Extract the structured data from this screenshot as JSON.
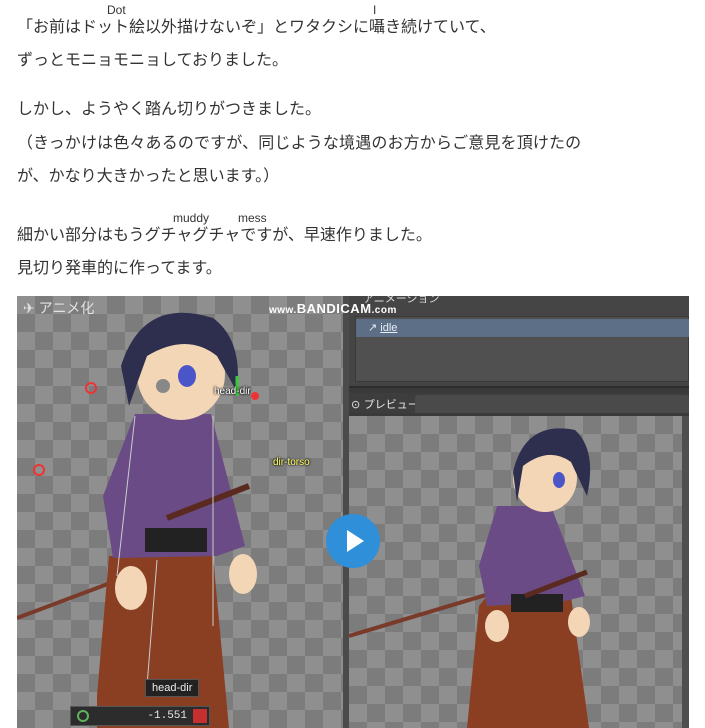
{
  "article": {
    "line1": "「お前はドット絵以外描けないぞ」とワタクシに囁き続けていて、",
    "line2": "ずっとモニョモニョしておりました。",
    "line3": "しかし、ようやく踏ん切りがつきました。",
    "line4": "（きっかけは色々あるのですが、同じような境遇のお方からご意見を頂けたの",
    "line5": "が、かなり大きかったと思います。）",
    "line6": "細かい部分はもうグチャグチャですが、早速作りました。",
    "line7": "見切り発車的に作ってます。",
    "ruby_dot": "Dot",
    "ruby_i": "I",
    "ruby_muddy": "muddy",
    "ruby_mess": "mess"
  },
  "video": {
    "watermark_www": "www.",
    "watermark_brand": "BANDICAM",
    "watermark_tld": ".com",
    "left_tab": "アニメ化",
    "top_tab": "アニメーション",
    "anim_item": "idle",
    "preview_label": "プレビュー",
    "bone_head_dir": "head-dir",
    "bone_dir_torso": "dir-torso",
    "tooltip": "head-dir",
    "value": "-1.551",
    "play_label": "play"
  },
  "colors": {
    "accent_play": "#2f8fd8",
    "purple_kimono": "#6a4b86",
    "hakama": "#8a3f22"
  }
}
